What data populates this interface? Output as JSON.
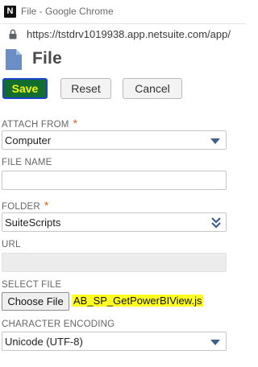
{
  "window": {
    "logo_letter": "N",
    "title": "File - Google Chrome",
    "url": "https://tstdrv1019938.app.netsuite.com/app/"
  },
  "page": {
    "title": "File"
  },
  "buttons": {
    "save": "Save",
    "reset": "Reset",
    "cancel": "Cancel"
  },
  "form": {
    "attach_from": {
      "label": "ATTACH FROM",
      "required_mark": "*",
      "value": "Computer"
    },
    "file_name": {
      "label": "FILE NAME",
      "value": ""
    },
    "folder": {
      "label": "FOLDER",
      "required_mark": "*",
      "value": "SuiteScripts"
    },
    "url": {
      "label": "URL",
      "value": ""
    },
    "select_file": {
      "label": "SELECT FILE",
      "button": "Choose File",
      "chosen_file": "AB_SP_GetPowerBIView.js"
    },
    "character_encoding": {
      "label": "CHARACTER ENCODING",
      "value": "Unicode (UTF-8)"
    }
  },
  "colors": {
    "save_bg": "#126d2f",
    "save_text": "#f6f50a",
    "required": "#e0601a",
    "dropdown_caret": "#3d5f8a",
    "highlight": "#ffff22"
  }
}
